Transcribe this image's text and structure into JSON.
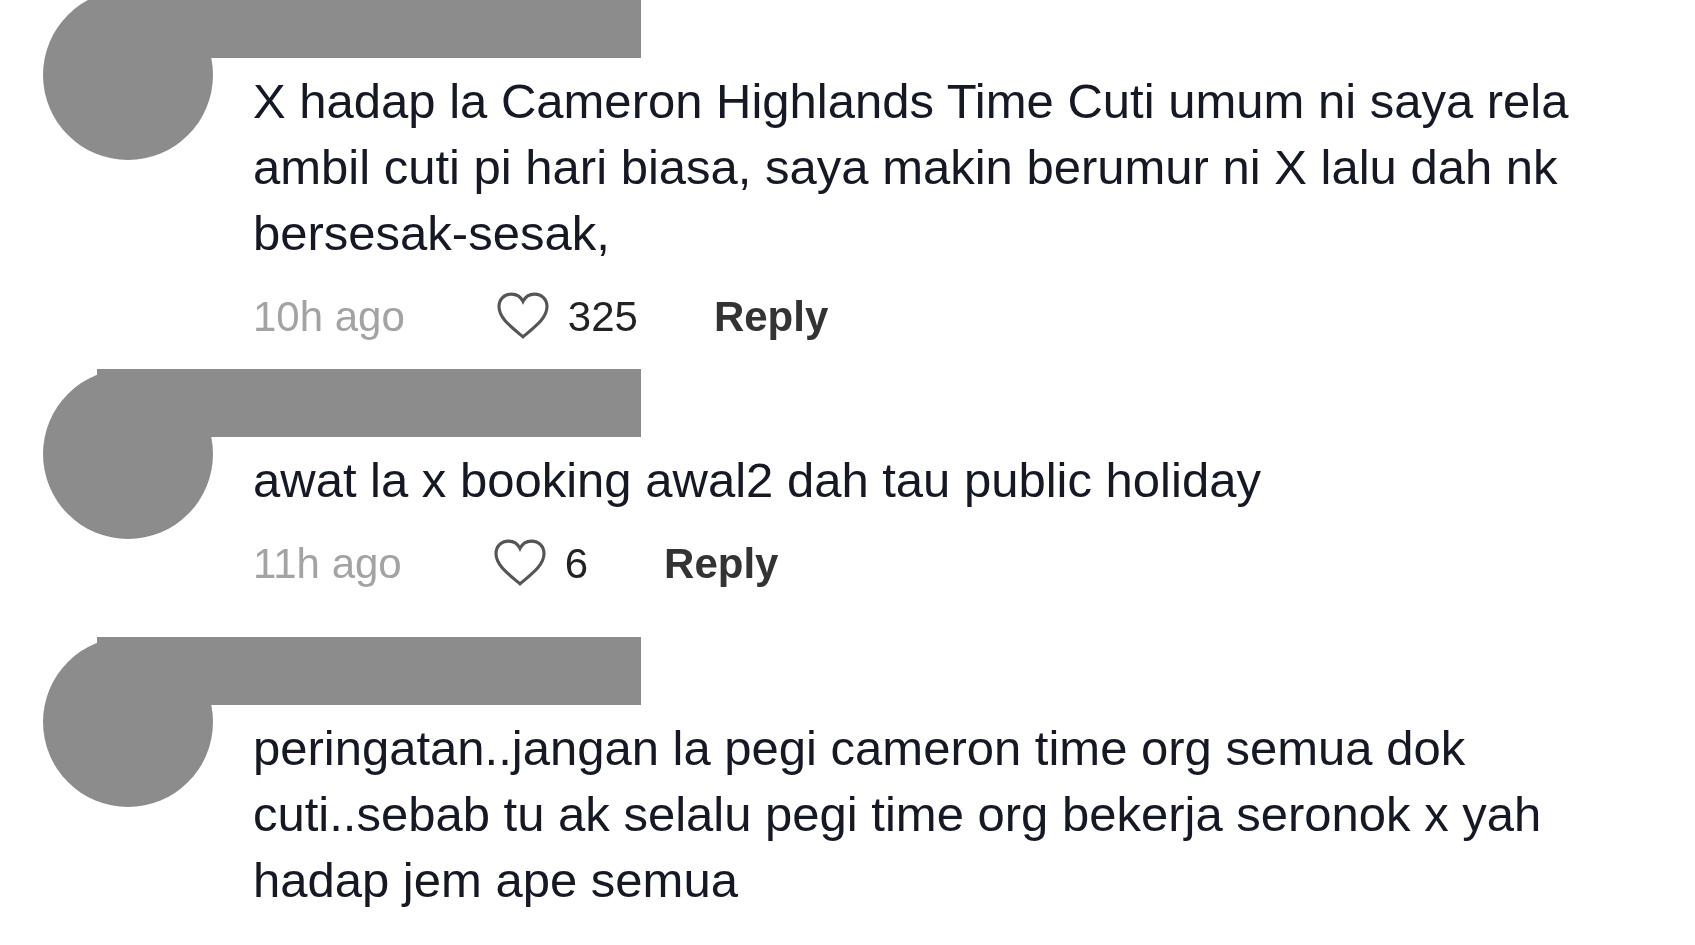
{
  "comments": [
    {
      "text": "X hadap la Cameron Highlands Time Cuti umum ni saya rela ambil cuti pi hari biasa, saya makin berumur ni X lalu dah nk bersesak-sesak,",
      "time": "10h ago",
      "likes": "325",
      "reply": "Reply"
    },
    {
      "text": "awat la x booking awal2 dah tau public holiday",
      "time": "11h ago",
      "likes": "6",
      "reply": "Reply"
    },
    {
      "text": "peringatan..jangan la pegi cameron time org semua dok cuti..sebab tu ak selalu pegi time org bekerja seronok x yah hadap jem ape semua"
    }
  ]
}
